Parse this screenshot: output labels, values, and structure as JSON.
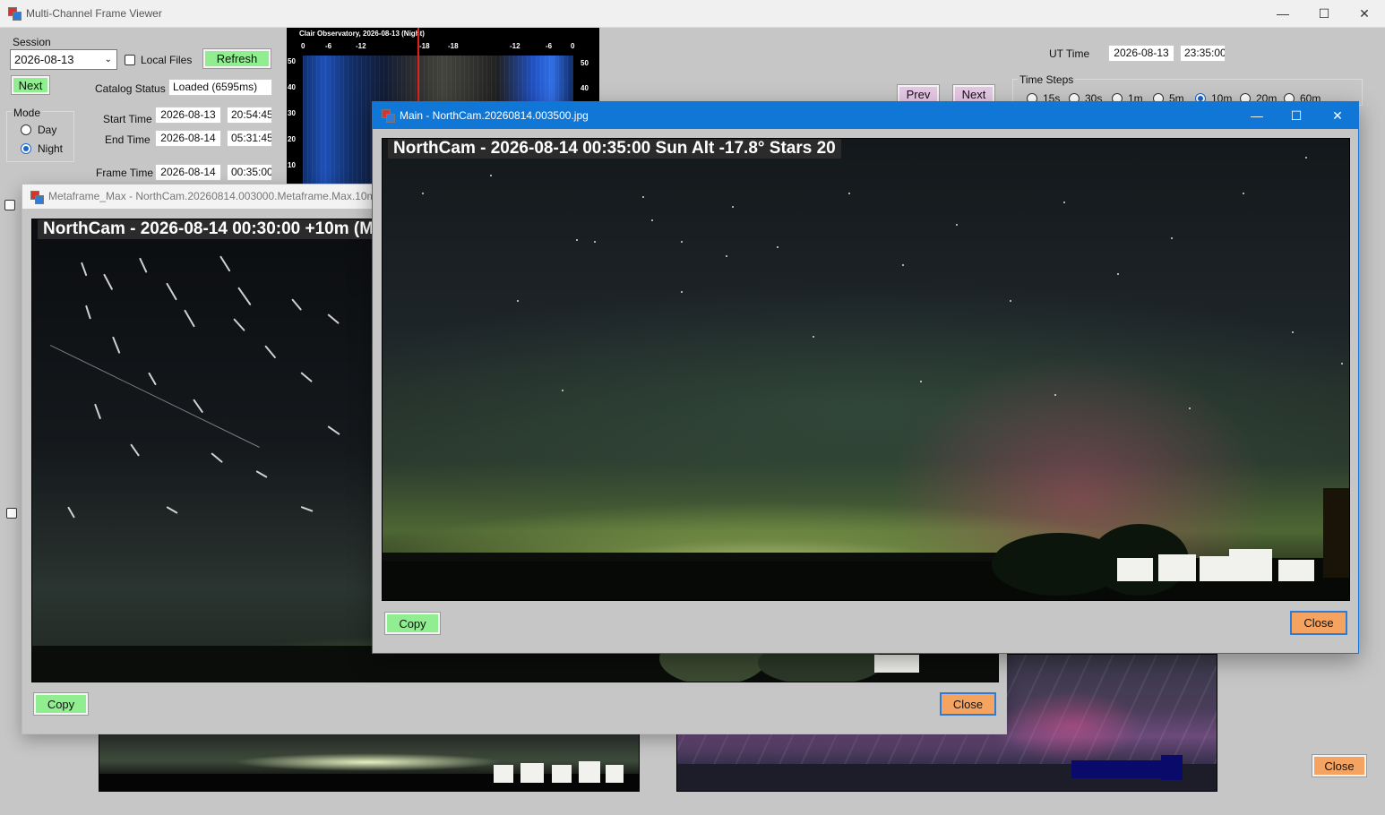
{
  "app": {
    "title": "Multi-Channel Frame Viewer",
    "window_controls": {
      "minimize": "—",
      "maximize": "☐",
      "close": "✕"
    }
  },
  "session": {
    "label": "Session",
    "value": "2026-08-13",
    "local_files_label": "Local Files",
    "refresh_label": "Refresh",
    "next_label": "Next",
    "catalog_status_label": "Catalog Status",
    "catalog_status_value": "Loaded (6595ms)"
  },
  "mode": {
    "label": "Mode",
    "options": [
      "Day",
      "Night"
    ],
    "selected": "Night"
  },
  "times": {
    "start_label": "Start Time",
    "start_date": "2026-08-13",
    "start_time": "20:54:45",
    "end_label": "End Time",
    "end_date": "2026-08-14",
    "end_time": "05:31:45",
    "frame_label": "Frame Time",
    "frame_date": "2026-08-14",
    "frame_time": "00:35:00"
  },
  "keogram": {
    "title": "Clair Observatory, 2026-08-13 (Night)",
    "top_ticks": [
      "0",
      "-6",
      "-12",
      "-18",
      "-18",
      "-12",
      "-6",
      "0"
    ],
    "left_ticks": [
      "50",
      "40",
      "30",
      "20",
      "10"
    ],
    "right_ticks": [
      "50",
      "40"
    ]
  },
  "ut_time": {
    "label": "UT Time",
    "date": "2026-08-13",
    "time": "23:35:00"
  },
  "nav": {
    "prev_label": "Prev",
    "next_label": "Next"
  },
  "time_steps": {
    "label": "Time Steps",
    "options": [
      "15s",
      "30s",
      "1m",
      "5m",
      "10m",
      "20m",
      "60m"
    ],
    "selected": "10m"
  },
  "meta_window": {
    "title": "Metaframe_Max - NorthCam.20260814.003000.Metaframe.Max.10m.",
    "overlay": "NorthCam - 2026-08-14 00:30:00 +10m  (M",
    "copy_label": "Copy",
    "close_label": "Close"
  },
  "main_window": {
    "title": "Main - NorthCam.20260814.003500.jpg",
    "overlay": "NorthCam - 2026-08-14 00:35:00  Sun Alt -17.8° Stars 20",
    "copy_label": "Copy",
    "close_label": "Close",
    "controls": {
      "minimize": "—",
      "maximize": "☐",
      "close": "✕"
    }
  },
  "footer": {
    "close_label": "Close"
  }
}
